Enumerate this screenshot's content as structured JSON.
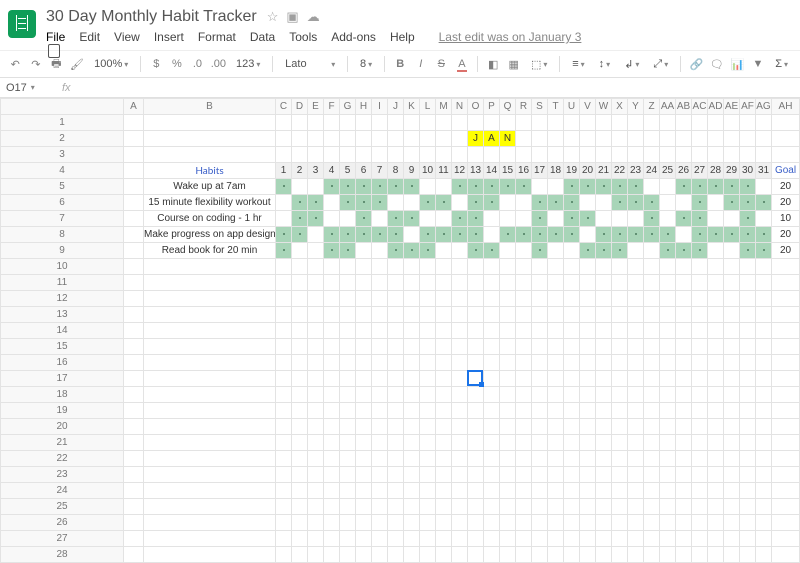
{
  "doc": {
    "title": "30 Day Monthly Habit Tracker",
    "last_edit": "Last edit was on January 3"
  },
  "menu": [
    "File",
    "Edit",
    "View",
    "Insert",
    "Format",
    "Data",
    "Tools",
    "Add-ons",
    "Help"
  ],
  "toolbar": {
    "zoom": "100%",
    "currency": "$",
    "pct": "%",
    "dec_dec": ".0",
    "dec_inc": ".00",
    "num_fmt": "123",
    "font": "Lato",
    "size": "8",
    "bold": "B",
    "italic": "I",
    "strike": "S",
    "color_a": "A"
  },
  "formula": {
    "cell_ref": "O17"
  },
  "columns": [
    "",
    "A",
    "B",
    "C",
    "D",
    "E",
    "F",
    "G",
    "H",
    "I",
    "J",
    "K",
    "L",
    "M",
    "N",
    "O",
    "P",
    "Q",
    "R",
    "S",
    "T",
    "U",
    "V",
    "W",
    "X",
    "Y",
    "Z",
    "AA",
    "AB",
    "AC",
    "AD",
    "AE",
    "AF",
    "AG",
    "AH"
  ],
  "jan_letters": [
    "J",
    "A",
    "N"
  ],
  "day_nums": [
    "1",
    "2",
    "3",
    "4",
    "5",
    "6",
    "7",
    "8",
    "9",
    "10",
    "11",
    "12",
    "13",
    "14",
    "15",
    "16",
    "17",
    "18",
    "19",
    "20",
    "21",
    "22",
    "23",
    "24",
    "25",
    "26",
    "27",
    "28",
    "29",
    "30",
    "31"
  ],
  "habits_label": "Habits",
  "goal_label": "Goal",
  "habits": [
    {
      "name": "Wake up at 7am",
      "goal": "20",
      "hits": [
        1,
        0,
        0,
        1,
        1,
        1,
        1,
        1,
        1,
        0,
        0,
        1,
        1,
        1,
        1,
        1,
        0,
        0,
        1,
        1,
        1,
        1,
        1,
        0,
        0,
        1,
        1,
        1,
        1,
        1,
        0
      ]
    },
    {
      "name": "15 minute flexibility workout",
      "goal": "20",
      "hits": [
        0,
        1,
        1,
        0,
        1,
        1,
        1,
        0,
        0,
        1,
        1,
        0,
        1,
        1,
        0,
        0,
        1,
        1,
        1,
        0,
        0,
        1,
        1,
        1,
        0,
        0,
        1,
        0,
        1,
        1,
        1
      ]
    },
    {
      "name": "Course on coding - 1 hr",
      "goal": "10",
      "hits": [
        0,
        1,
        1,
        0,
        0,
        1,
        0,
        1,
        1,
        0,
        0,
        1,
        1,
        0,
        0,
        0,
        1,
        0,
        1,
        1,
        0,
        0,
        0,
        1,
        0,
        1,
        1,
        0,
        0,
        1,
        0
      ]
    },
    {
      "name": "Make progress on app design",
      "goal": "20",
      "hits": [
        1,
        1,
        0,
        1,
        1,
        1,
        1,
        1,
        0,
        1,
        1,
        1,
        1,
        0,
        1,
        1,
        1,
        1,
        1,
        0,
        1,
        1,
        1,
        1,
        1,
        0,
        1,
        1,
        1,
        1,
        1
      ]
    },
    {
      "name": "Read book for 20 min",
      "goal": "20",
      "hits": [
        1,
        0,
        0,
        1,
        1,
        0,
        0,
        1,
        1,
        1,
        0,
        0,
        1,
        1,
        0,
        0,
        1,
        0,
        0,
        1,
        1,
        1,
        0,
        0,
        1,
        1,
        1,
        0,
        0,
        1,
        1
      ]
    }
  ],
  "selected_cell": "O17",
  "row_count": 28
}
